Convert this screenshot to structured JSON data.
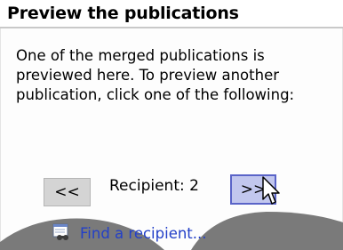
{
  "header": {
    "title": "Preview the publications"
  },
  "panel": {
    "description": "One of the merged publications is previewed here. To preview another publication, click one of the following:",
    "prev_label": "<<",
    "next_label": ">>",
    "recipient_label": "Recipient: 2",
    "find_link": "Find a recipient..."
  },
  "icons": {
    "find": "find-recipient-icon",
    "cursor": "mouse-cursor-icon"
  },
  "colors": {
    "accent_border": "#5a64c8",
    "link": "#2340c8",
    "next_button_bg": "#c2c7ee"
  }
}
